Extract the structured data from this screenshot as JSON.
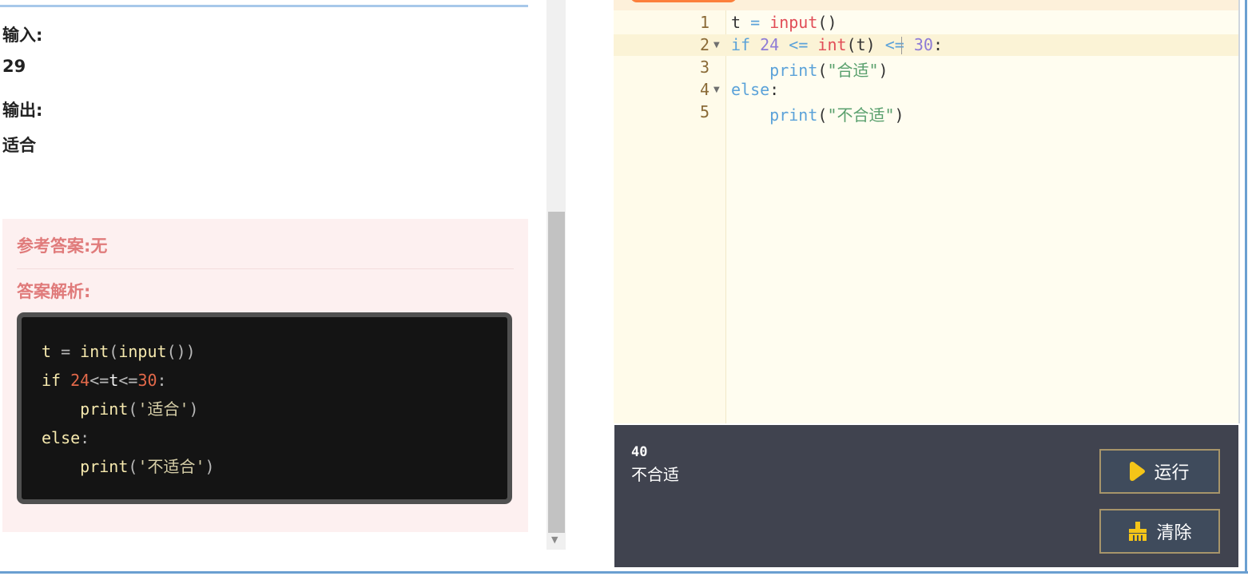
{
  "problem": {
    "input_label": "输入:",
    "input_value": "29",
    "output_label": "输出:",
    "output_value": "适合"
  },
  "answer": {
    "reference_label": "参考答案:无",
    "explanation_label": "答案解析:",
    "code_lines": [
      "t = int(input())",
      "if 24<=t<=30:",
      "    print('适合')",
      "else:",
      "    print('不适合')"
    ]
  },
  "editor": {
    "line_numbers": [
      "1",
      "2",
      "3",
      "4",
      "5"
    ],
    "lines": [
      "t = input()",
      "if 24 <= int(t) <= 30:",
      "    print(\"合适\")",
      "else:",
      "    print(\"不合适\")"
    ],
    "active_line": 2,
    "fold_lines": [
      2,
      4
    ]
  },
  "console": {
    "input_echo": "40",
    "output": "不合适"
  },
  "buttons": {
    "run_label": "运行",
    "clear_label": "清除"
  },
  "icons": {
    "run": "play-icon",
    "clear": "broom-icon"
  },
  "colors": {
    "accent_orange": "#fc7f3b",
    "answer_red": "#e07b7b",
    "console_bg": "#40434f",
    "button_border": "#a7956a",
    "play_yellow": "#f5c518"
  }
}
